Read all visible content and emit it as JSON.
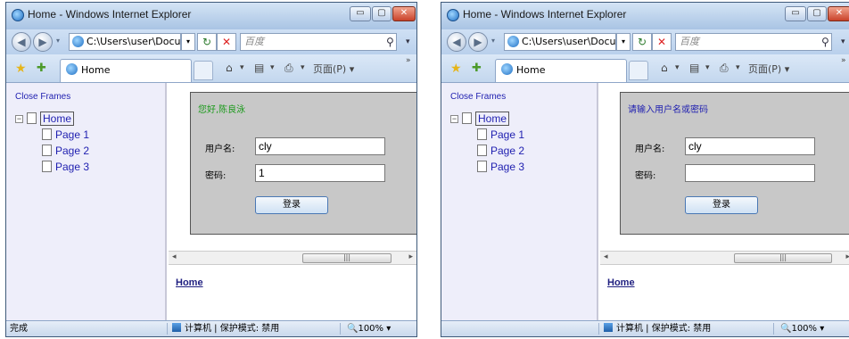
{
  "windows": [
    {
      "title": "Home - Windows Internet Explorer",
      "address": "C:\\Users\\user\\Docum",
      "search_placeholder": "百度",
      "tab_label": "Home",
      "page_menu": "页面(P)",
      "close_frames": "Close Frames",
      "tree": {
        "root": "Home",
        "children": [
          "Page 1",
          "Page 2",
          "Page 3"
        ]
      },
      "greeting": "您好,陈良泳",
      "username_label": "用户名:",
      "username_value": "cly",
      "password_label": "密码:",
      "password_value": "1",
      "login_button": "登录",
      "home_link": "Home",
      "status_left": "完成",
      "status_zone": "计算机 | 保护模式: 禁用",
      "zoom": "100%",
      "greeting_color": "#1a9a1a"
    },
    {
      "title": "Home - Windows Internet Explorer",
      "address": "C:\\Users\\user\\Docur",
      "search_placeholder": "百度",
      "tab_label": "Home",
      "page_menu": "页面(P)",
      "close_frames": "Close Frames",
      "tree": {
        "root": "Home",
        "children": [
          "Page 1",
          "Page 2",
          "Page 3"
        ]
      },
      "greeting": "请输入用户名或密码",
      "username_label": "用户名:",
      "username_value": "cly",
      "password_label": "密码:",
      "password_value": "",
      "login_button": "登录",
      "home_link": "Home",
      "status_left": "",
      "status_zone": "计算机 | 保护模式: 禁用",
      "zoom": "100%",
      "greeting_color": "#1f1fb0"
    }
  ],
  "glyphs": {
    "minimize": "▭",
    "maximize": "▢",
    "close": "✕",
    "back": "◀",
    "forward": "▶",
    "refresh": "↻",
    "stop": "✕",
    "search": "⚲",
    "home": "⌂",
    "feeds": "▤",
    "print": "⎙",
    "tree_toggle": "−",
    "scroll_grip": "|||",
    "more": "»"
  }
}
